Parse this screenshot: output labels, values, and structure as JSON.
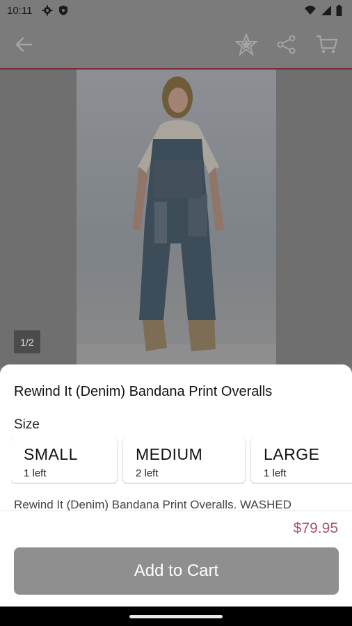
{
  "status_bar": {
    "time": "10:11"
  },
  "hero": {
    "page_indicator": "1/2"
  },
  "product": {
    "title": "Rewind It (Denim) Bandana Print Overalls",
    "size_label": "Size",
    "sizes": [
      {
        "name": "SMALL",
        "stock": "1 left"
      },
      {
        "name": "MEDIUM",
        "stock": "2 left"
      },
      {
        "name": "LARGE",
        "stock": "1 left"
      }
    ],
    "description": "Rewind It (Denim) Bandana Print Overalls. WASHED",
    "price": "$79.95"
  },
  "actions": {
    "add_to_cart": "Add to Cart"
  },
  "colors": {
    "accent": "#a25670",
    "divider": "#7a2b3a",
    "button": "#8f8f8f"
  },
  "icons": [
    "settings-icon",
    "shield-icon",
    "wifi-icon",
    "signal-icon",
    "battery-icon",
    "back-arrow-icon",
    "star-icon",
    "share-icon",
    "cart-icon"
  ]
}
